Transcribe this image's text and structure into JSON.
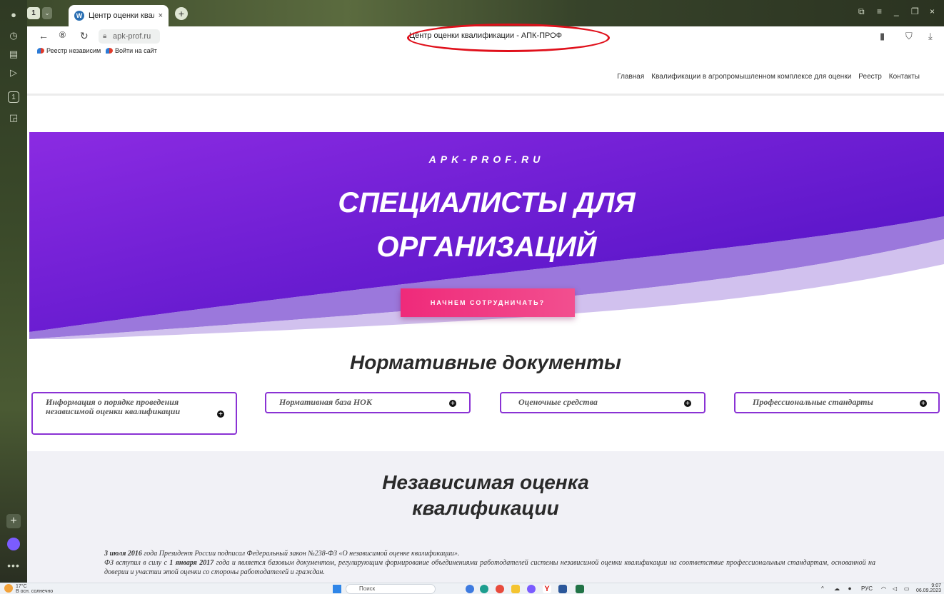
{
  "browser": {
    "tab_count": "1",
    "tab_dropdown": "⌄",
    "tab_title": "Центр оценки квалиф",
    "tab_close": "×",
    "new_tab": "+",
    "address": "apk-prof.ru",
    "page_title": "Центр оценки квалификации - АПК-ПРОФ",
    "bookmarks": [
      "Реестр независим",
      "Войти на сайт"
    ]
  },
  "site_nav": [
    "Главная",
    "Квалификации в агропромышленном комплексе для оценки",
    "Реестр",
    "Контакты"
  ],
  "hero": {
    "kicker": "APK-PROF.RU",
    "headline_line1": "Специалисты для",
    "headline_line2": "организаций",
    "cta": "НАЧНЕМ СОТРУДНИЧАТЬ?",
    "colors": {
      "gradient_start": "#8b2be2",
      "gradient_end": "#4b0fc1",
      "cta": "#ef2a7a"
    }
  },
  "docs": {
    "title": "Нормативные документы",
    "cards": [
      "Информация о порядке проведения независимой оценки квалификации",
      "Нормативная база НОК",
      "Оценочные средства",
      "Профессиональные стандарты"
    ]
  },
  "independent": {
    "title_line1": "Независимая оценка",
    "title_line2": "квалификации",
    "para_date": "3 июля 2016",
    "para1": " года Президент России подписал Федеральный закон №238-ФЗ «О независимой оценке квалификации».",
    "para2_a": "ФЗ вступил в силу с ",
    "para2_date": "1 января 2017",
    "para2_b": " года и является базовым документом, регулирующим формирование объединениями работодателей системы независимой оценки квалификации на соответствие профессиональным стандартам, основанной на доверии и участии этой оценки со стороны работодателей и граждан."
  },
  "taskbar": {
    "weather_temp": "17°C",
    "weather_desc": "В осн. солнечно",
    "search_placeholder": "Поиск",
    "lang": "РУС",
    "time": "9:07",
    "date": "06.09.2023"
  }
}
